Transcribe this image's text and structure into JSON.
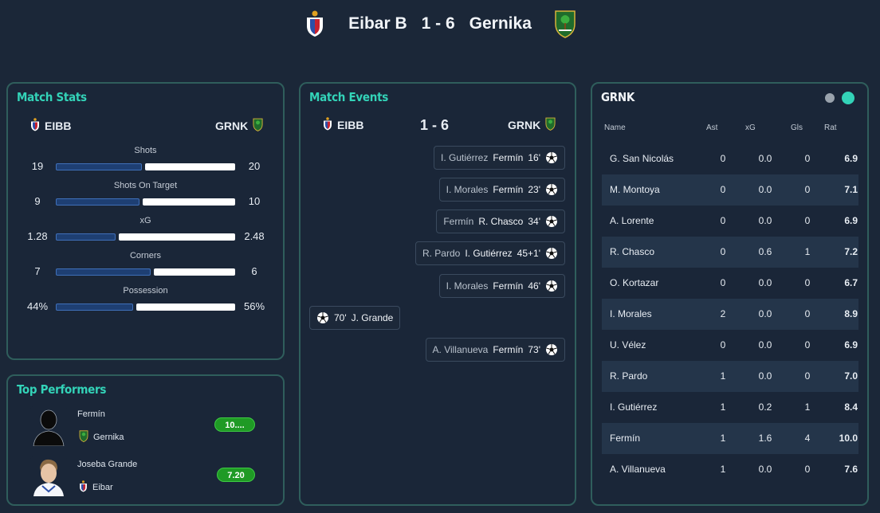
{
  "header": {
    "home": "Eibar B",
    "score": "1 - 6",
    "away": "Gernika",
    "home_logo": "eibar-crest-icon",
    "away_logo": "gernika-crest-icon"
  },
  "stats": {
    "title": "Match Stats",
    "home_abbr": "EIBB",
    "away_abbr": "GRNK",
    "rows": [
      {
        "label": "Shots",
        "home": "19",
        "away": "20",
        "home_value": 19,
        "away_value": 20
      },
      {
        "label": "Shots On Target",
        "home": "9",
        "away": "10",
        "home_value": 9,
        "away_value": 10
      },
      {
        "label": "xG",
        "home": "1.28",
        "away": "2.48",
        "home_value": 1.28,
        "away_value": 2.48
      },
      {
        "label": "Corners",
        "home": "7",
        "away": "6",
        "home_value": 7,
        "away_value": 6
      },
      {
        "label": "Possession",
        "home": "44%",
        "away": "56%",
        "home_value": 44,
        "away_value": 56
      }
    ]
  },
  "performers": {
    "title": "Top Performers",
    "players": [
      {
        "name": "Fermín",
        "team": "Gernika",
        "rating": "10...."
      },
      {
        "name": "Joseba Grande",
        "team": "Eibar",
        "rating": "7.20"
      }
    ]
  },
  "events": {
    "title": "Match Events",
    "home_abbr": "EIBB",
    "away_abbr": "GRNK",
    "score": "1 - 6",
    "items": [
      {
        "side": "away",
        "assist": "I. Gutiérrez",
        "scorer": "Fermín",
        "minute": "16'"
      },
      {
        "side": "away",
        "assist": "I. Morales",
        "scorer": "Fermín",
        "minute": "23'"
      },
      {
        "side": "away",
        "assist": "Fermín",
        "scorer": "R. Chasco",
        "minute": "34'"
      },
      {
        "side": "away",
        "assist": "R. Pardo",
        "scorer": "I. Gutiérrez",
        "minute": "45+1'"
      },
      {
        "side": "away",
        "assist": "I. Morales",
        "scorer": "Fermín",
        "minute": "46'"
      },
      {
        "side": "home",
        "assist": "",
        "scorer": "J. Grande",
        "minute": "70'"
      },
      {
        "side": "away",
        "assist": "A. Villanueva",
        "scorer": "Fermín",
        "minute": "73'"
      }
    ]
  },
  "lineup": {
    "title": "GRNK",
    "columns": {
      "name": "Name",
      "ast": "Ast",
      "xg": "xG",
      "gls": "Gls",
      "rat": "Rat"
    },
    "rows": [
      {
        "name": "G. San Nicolás",
        "ast": "0",
        "xg": "0.0",
        "gls": "0",
        "rat": "6.9"
      },
      {
        "name": "M. Montoya",
        "ast": "0",
        "xg": "0.0",
        "gls": "0",
        "rat": "7.1"
      },
      {
        "name": "A. Lorente",
        "ast": "0",
        "xg": "0.0",
        "gls": "0",
        "rat": "6.9"
      },
      {
        "name": "R. Chasco",
        "ast": "0",
        "xg": "0.6",
        "gls": "1",
        "rat": "7.2"
      },
      {
        "name": "O. Kortazar",
        "ast": "0",
        "xg": "0.0",
        "gls": "0",
        "rat": "6.7"
      },
      {
        "name": "I. Morales",
        "ast": "2",
        "xg": "0.0",
        "gls": "0",
        "rat": "8.9"
      },
      {
        "name": "U. Vélez",
        "ast": "0",
        "xg": "0.0",
        "gls": "0",
        "rat": "6.9"
      },
      {
        "name": "R. Pardo",
        "ast": "1",
        "xg": "0.0",
        "gls": "0",
        "rat": "7.0"
      },
      {
        "name": "I. Gutiérrez",
        "ast": "1",
        "xg": "0.2",
        "gls": "1",
        "rat": "8.4"
      },
      {
        "name": "Fermín",
        "ast": "1",
        "xg": "1.6",
        "gls": "4",
        "rat": "10.0"
      },
      {
        "name": "A. Villanueva",
        "ast": "1",
        "xg": "0.0",
        "gls": "0",
        "rat": "7.6"
      }
    ]
  },
  "colors": {
    "accent": "#33d3b8",
    "home_bar": "#1e3f73",
    "away_bar": "#ffffff",
    "rating_badge": "#1f9a25"
  }
}
